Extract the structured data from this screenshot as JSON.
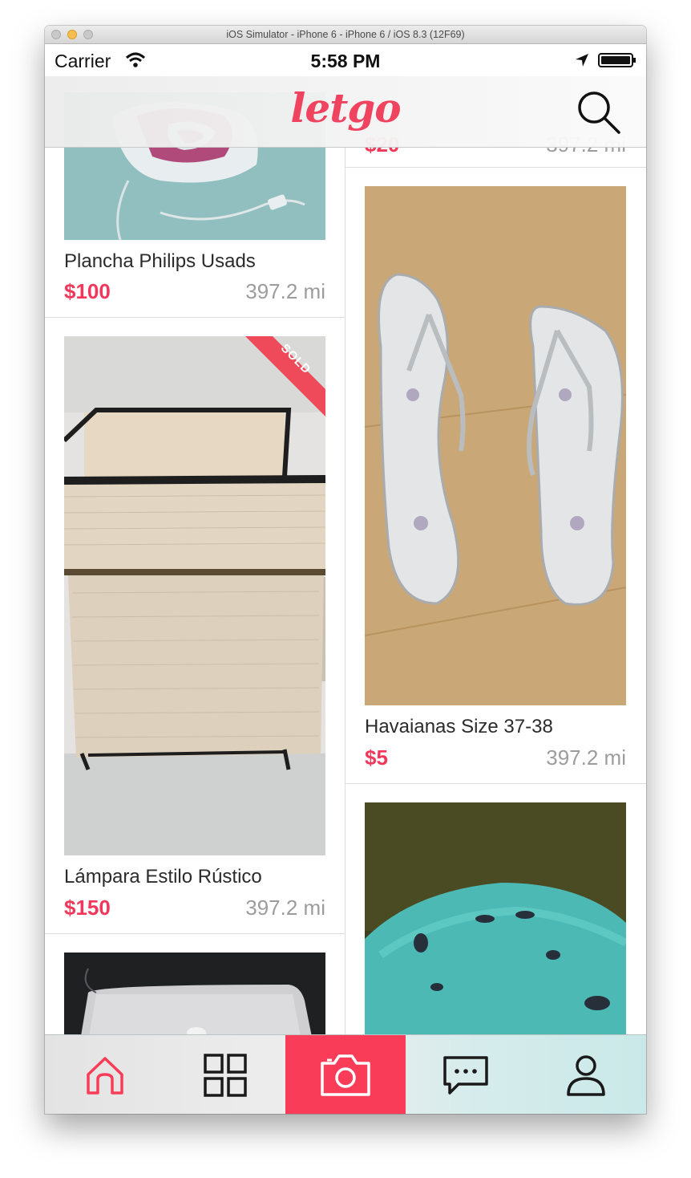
{
  "window": {
    "title": "iOS Simulator - iPhone 6 - iPhone 6 / iOS 8.3 (12F69)"
  },
  "status_bar": {
    "carrier": "Carrier",
    "time": "5:58 PM"
  },
  "navbar": {
    "logo": "letgo"
  },
  "listings": [
    {
      "title": "Plancha Philips Usads",
      "price": "$100",
      "distance": "397.2 mi",
      "sold": false
    },
    {
      "title": "Lámpara Estilo Rústico",
      "price": "$150",
      "distance": "397.2 mi",
      "sold": true,
      "badge": "SOLD"
    },
    {
      "title": "",
      "price": "",
      "distance": "",
      "sold": false
    },
    {
      "title": "",
      "price": "$20",
      "distance": "397.2 mi",
      "sold": false
    },
    {
      "title": "Havaianas Size 37-38",
      "price": "$5",
      "distance": "397.2 mi",
      "sold": false
    },
    {
      "title": "",
      "price": "",
      "distance": "",
      "sold": false
    }
  ],
  "tab_bar": {
    "items": [
      {
        "name": "home",
        "icon": "home-icon",
        "active": false
      },
      {
        "name": "categories",
        "icon": "grid-icon",
        "active": false
      },
      {
        "name": "sell",
        "icon": "camera-icon",
        "active": true
      },
      {
        "name": "chats",
        "icon": "chat-bubble-icon",
        "active": false
      },
      {
        "name": "profile",
        "icon": "person-icon",
        "active": false
      }
    ]
  },
  "colors": {
    "accent": "#f93d58",
    "price": "#f1385a",
    "distance": "#9c9c9c"
  }
}
